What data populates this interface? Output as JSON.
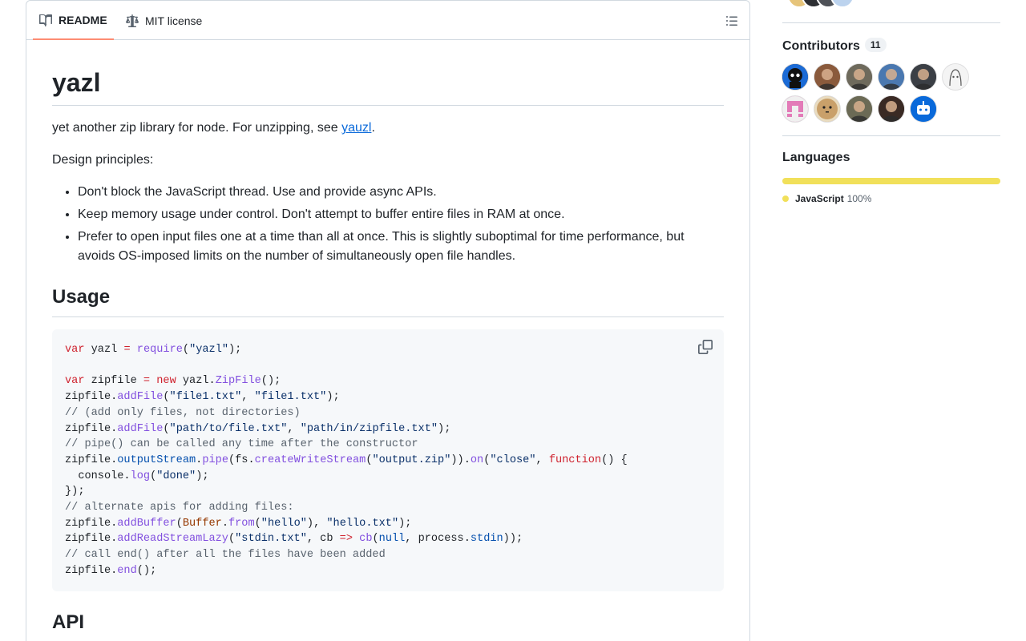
{
  "readme_tabs": [
    {
      "label": "README",
      "icon": "book-icon"
    },
    {
      "label": "MIT license",
      "icon": "law-icon"
    }
  ],
  "article": {
    "title": "yazl",
    "intro_text": "yet another zip library for node. For unzipping, see ",
    "intro_link": "yauzl",
    "intro_end": ".",
    "design_heading": "Design principles:",
    "principles": [
      "Don't block the JavaScript thread. Use and provide async APIs.",
      "Keep memory usage under control. Don't attempt to buffer entire files in RAM at once.",
      "Prefer to open input files one at a time than all at once. This is slightly suboptimal for time performance, but avoids OS-imposed limits on the number of simultaneously open file handles."
    ],
    "usage_heading": "Usage",
    "api_heading": "API",
    "code_lines": [
      "var yazl = require(\"yazl\");",
      "",
      "var zipfile = new yazl.ZipFile();",
      "zipfile.addFile(\"file1.txt\", \"file1.txt\");",
      "// (add only files, not directories)",
      "zipfile.addFile(\"path/to/file.txt\", \"path/in/zipfile.txt\");",
      "// pipe() can be called any time after the constructor",
      "zipfile.outputStream.pipe(fs.createWriteStream(\"output.zip\")).on(\"close\", function() {",
      "  console.log(\"done\");",
      "});",
      "// alternate apis for adding files:",
      "zipfile.addBuffer(Buffer.from(\"hello\"), \"hello.txt\");",
      "zipfile.addReadStreamLazy(\"stdin.txt\", cb => cb(null, process.stdin));",
      "// call end() after all the files have been added",
      "zipfile.end();"
    ]
  },
  "sidebar": {
    "contributors_heading": "Contributors",
    "contributors_count": "11",
    "contributors": [
      {
        "kind": "octocat",
        "bg": "#1b1f24"
      },
      {
        "kind": "person",
        "bg": "#8a5a3c"
      },
      {
        "kind": "person",
        "bg": "#6e6a5c"
      },
      {
        "kind": "person",
        "bg": "#4a78b0"
      },
      {
        "kind": "person",
        "bg": "#3b3f45"
      },
      {
        "kind": "sketch",
        "bg": "#e9e9e9"
      },
      {
        "kind": "identicon",
        "bg": "#e37bb8"
      },
      {
        "kind": "face",
        "bg": "#c7a06b"
      },
      {
        "kind": "person",
        "bg": "#6b6a55"
      },
      {
        "kind": "person",
        "bg": "#3a2a24"
      },
      {
        "kind": "bot",
        "bg": "#0969da"
      }
    ],
    "languages_heading": "Languages",
    "language": {
      "name": "JavaScript",
      "percent": "100%",
      "color": "#f1e05a"
    }
  }
}
